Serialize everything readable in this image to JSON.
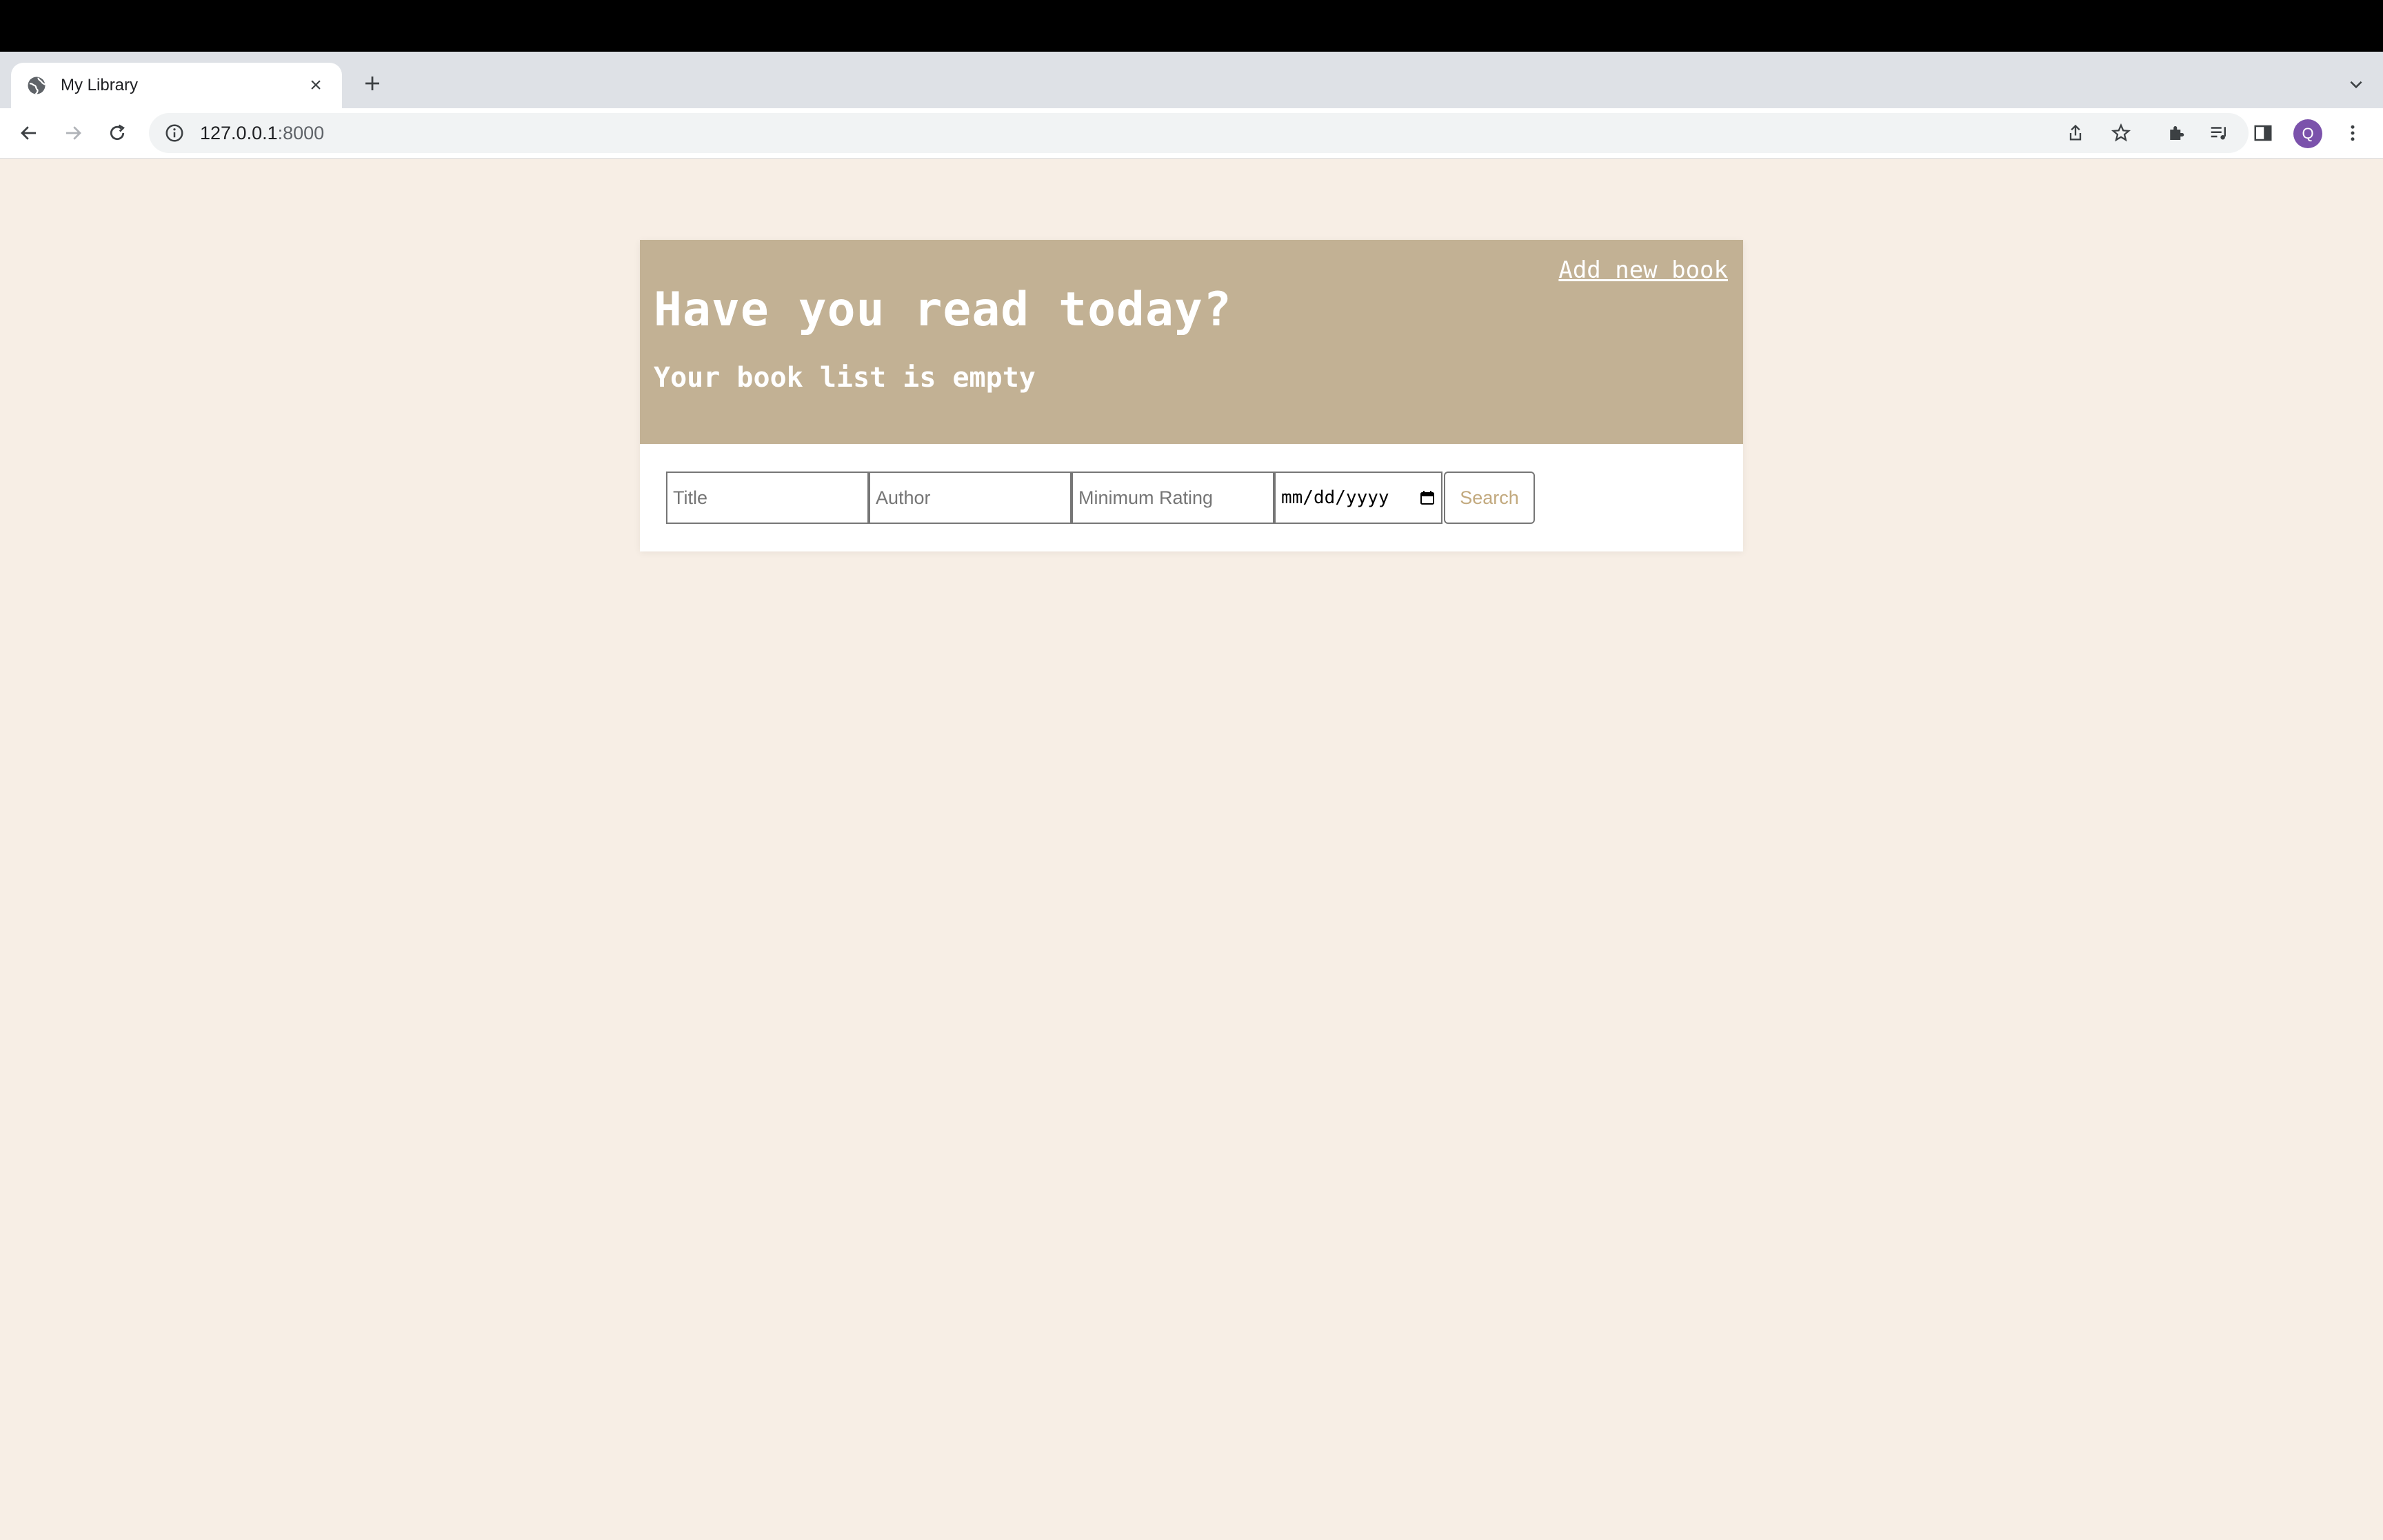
{
  "browser": {
    "tab": {
      "title": "My Library"
    },
    "address_bar": {
      "host": "127.0.0.1",
      "port": ":8000"
    },
    "profile_initial": "Q"
  },
  "page": {
    "add_link": "Add new book",
    "heading": "Have you read today?",
    "empty_message": "Your book list is empty",
    "search": {
      "title_placeholder": "Title",
      "author_placeholder": "Author",
      "rating_placeholder": "Minimum Rating",
      "date_placeholder": "mm/dd/yyyy",
      "button_label": "Search"
    }
  },
  "colors": {
    "page_background": "#f7eee5",
    "header_background": "#c2b194",
    "search_button_text": "#c2a97e"
  }
}
